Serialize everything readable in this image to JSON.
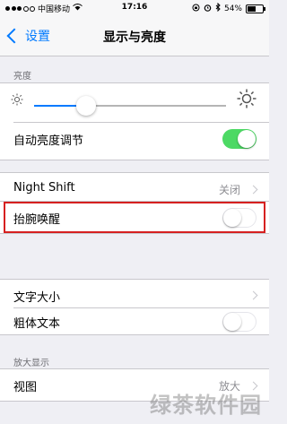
{
  "status_bar": {
    "carrier": "中国移动",
    "time": "17:16",
    "battery": "54%",
    "battery_level": 0.54
  },
  "nav": {
    "back_label": "设置",
    "title": "显示与亮度"
  },
  "brightness": {
    "header": "亮度",
    "level": 0.27,
    "auto_label": "自动亮度调节",
    "auto_on": true
  },
  "night_shift": {
    "label": "Night Shift",
    "value": "关闭"
  },
  "raise_to_wake": {
    "label": "抬腕唤醒",
    "on": false
  },
  "text": {
    "text_size_label": "文字大小",
    "bold_label": "粗体文本",
    "bold_on": false
  },
  "zoom": {
    "header": "放大显示",
    "view_label": "视图",
    "view_value": "放大"
  },
  "colors": {
    "accent": "#007aff",
    "toggle_on": "#4cd964",
    "highlight": "#d62020"
  },
  "watermark": "绿茶软件园"
}
